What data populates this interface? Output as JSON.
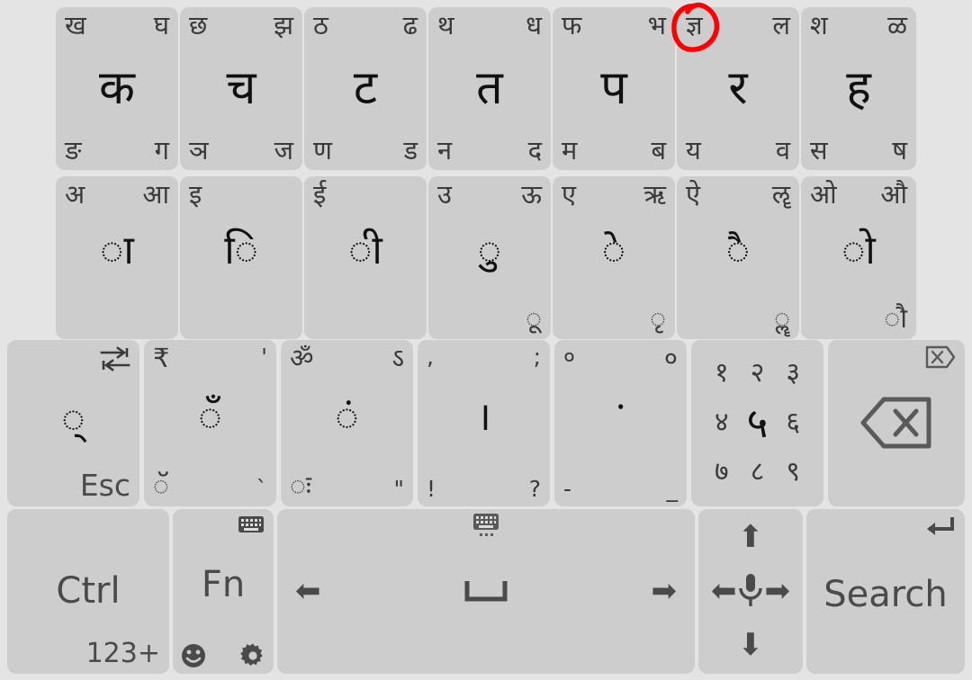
{
  "app": {
    "name": "Devanagari on-screen keyboard",
    "background_color": "#e4e4e4",
    "key_color": "#cdcdcd",
    "annotation_color": "#ff0000"
  },
  "annotation": {
    "shape": "hand-drawn-circle",
    "target": "gya-conjunct",
    "target_char": "ज्ञ",
    "color": "#ff0000"
  },
  "rows": {
    "consonants": [
      {
        "tl": "ख",
        "tr": "घ",
        "center": "क",
        "bl": "ङ",
        "br": "ग"
      },
      {
        "tl": "छ",
        "tr": "झ",
        "center": "च",
        "bl": "ञ",
        "br": "ज"
      },
      {
        "tl": "ठ",
        "tr": "ढ",
        "center": "ट",
        "bl": "ण",
        "br": "ड"
      },
      {
        "tl": "थ",
        "tr": "ध",
        "center": "त",
        "bl": "न",
        "br": "द"
      },
      {
        "tl": "फ",
        "tr": "भ",
        "center": "प",
        "bl": "म",
        "br": "ब"
      },
      {
        "tl": "ज्ञ",
        "tr": "ल",
        "center": "र",
        "bl": "य",
        "br": "व"
      },
      {
        "tl": "श",
        "tr": "ळ",
        "center": "ह",
        "bl": "स",
        "br": "ष"
      }
    ],
    "vowels": [
      {
        "tl": "अ",
        "tr": "आ",
        "center": "ा",
        "br": ""
      },
      {
        "tl": "इ",
        "tr": "",
        "center": "ि",
        "br": ""
      },
      {
        "tl": "ई",
        "tr": "",
        "center": "ी",
        "br": ""
      },
      {
        "tl": "उ",
        "tr": "ऊ",
        "center": "ु",
        "br": "ू"
      },
      {
        "tl": "ए",
        "tr": "ऋ",
        "center": "े",
        "br": "ृ"
      },
      {
        "tl": "ऐ",
        "tr": "ॡ",
        "center": "ै",
        "br": "ॣ"
      },
      {
        "tl": "ओ",
        "tr": "औ",
        "center": "ो",
        "br": "ौ"
      }
    ],
    "symbols": [
      {
        "tr_icon": "tab-icon",
        "center": "्",
        "br": "Esc",
        "name": "esc-key"
      },
      {
        "tl": "₹",
        "tr": "'",
        "center": "ँ",
        "bl": "ॅ",
        "br": "`",
        "name": "rupee-chandrabindu-key"
      },
      {
        "tl": "ॐ",
        "tr": "ऽ",
        "center": "ं",
        "bl": "ः",
        "br": "\"",
        "name": "om-anusvara-key"
      },
      {
        "tl": ",",
        "tr": ";",
        "center": "।",
        "bl": "!",
        "br": "?",
        "name": "danda-punctuation-key"
      },
      {
        "tl": "०",
        "tr": "०",
        "center": "ॱ",
        "bl": "-",
        "br": "_",
        "name": "zero-hyphen-key"
      },
      {
        "numerals": [
          "१",
          "२",
          "३",
          "४",
          "५",
          "६",
          "७",
          "८",
          "९"
        ],
        "highlight_index": 4,
        "name": "devanagari-numerals-key"
      },
      {
        "tr_icon": "delete-forward-icon",
        "center_icon": "backspace-icon",
        "name": "backspace-key"
      }
    ],
    "bottom": [
      {
        "label": "Ctrl",
        "br": "123+",
        "name": "ctrl-key"
      },
      {
        "label": "Fn",
        "tr_icon": "keyboard-icon",
        "bl_icon": "emoji-icon",
        "br_icon": "gear-icon",
        "name": "fn-key"
      },
      {
        "center_icon": "space-icon",
        "tc_icon": "keyboard-switch-icon",
        "left_icon": "arrow-left-icon",
        "right_icon": "arrow-right-icon",
        "name": "space-key"
      },
      {
        "center_icon": "mic-icon",
        "up_icon": "arrow-up-icon",
        "down_icon": "arrow-down-icon",
        "left_icon": "arrow-left-icon",
        "right_icon": "arrow-right-icon",
        "name": "dpad-mic-key"
      },
      {
        "label": "Search",
        "tr_icon": "enter-icon",
        "name": "search-key"
      }
    ]
  }
}
